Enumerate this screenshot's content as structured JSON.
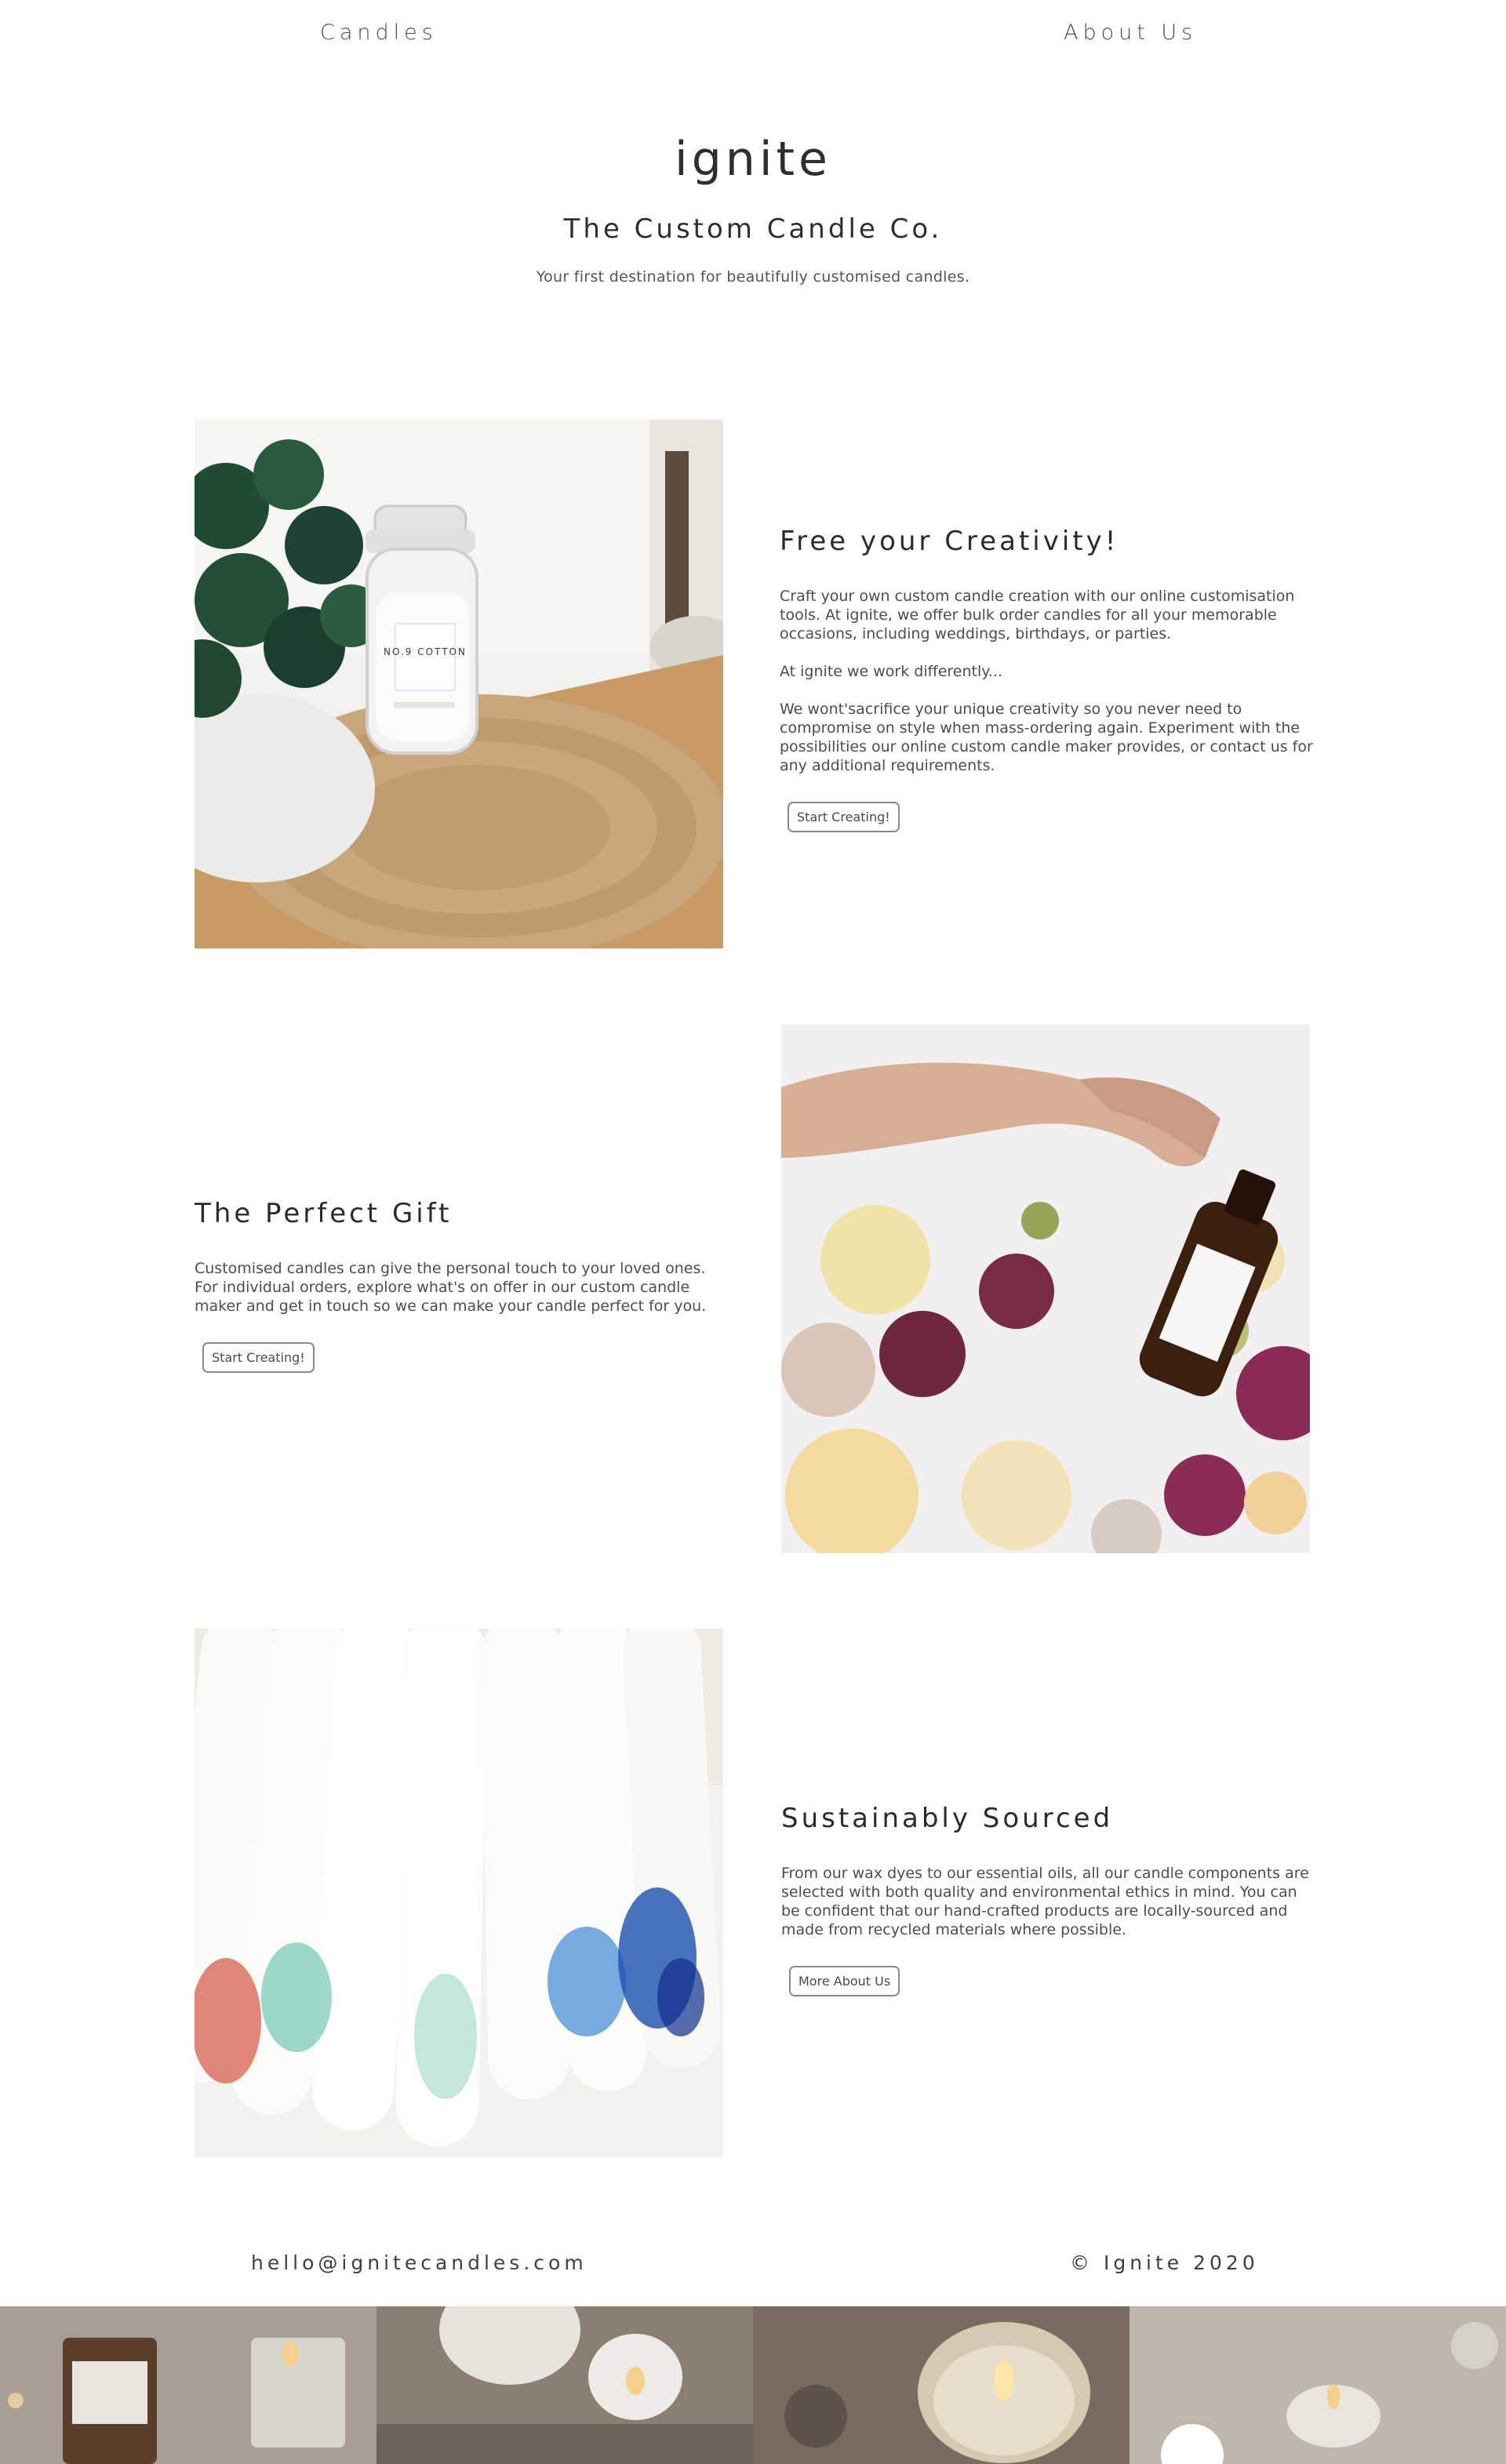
{
  "nav": {
    "candles": "Candles",
    "about": "About Us"
  },
  "hero": {
    "brand": "ignite",
    "tagline": "The Custom Candle Co.",
    "subtitle": "Your first destination for beautifully customised candles."
  },
  "sections": [
    {
      "title": "Free your Creativity!",
      "paragraphs": [
        "Craft your own custom candle creation with our online customisation tools. At ignite, we offer bulk order candles for all your memorable occasions, including weddings, birthdays, or parties.",
        "At ignite we work differently...",
        "We wont'sacrifice your unique creativity so you never need to compromise on style when mass-ordering again. Experiment with the possibilities our online custom candle maker provides, or contact us for any additional requirements."
      ],
      "button": "Start Creating!",
      "image_label": "NO.9 COTTON"
    },
    {
      "title": "The Perfect Gift",
      "paragraphs": [
        "Customised candles can give the personal touch to your loved ones. For individual orders, explore what's on offer in our custom candle maker and get in touch so we can make your candle perfect for you."
      ],
      "button": "Start Creating!"
    },
    {
      "title": "Sustainably Sourced",
      "paragraphs": [
        "From our wax dyes to our essential oils, all our candle components are selected with both quality and environmental ethics in mind. You can be confident that our hand-crafted products are locally-sourced and made from recycled materials where possible."
      ],
      "button": "More About Us"
    }
  ],
  "footer": {
    "email": "hello@ignitecandles.com",
    "copyright": "© Ignite 2020"
  }
}
